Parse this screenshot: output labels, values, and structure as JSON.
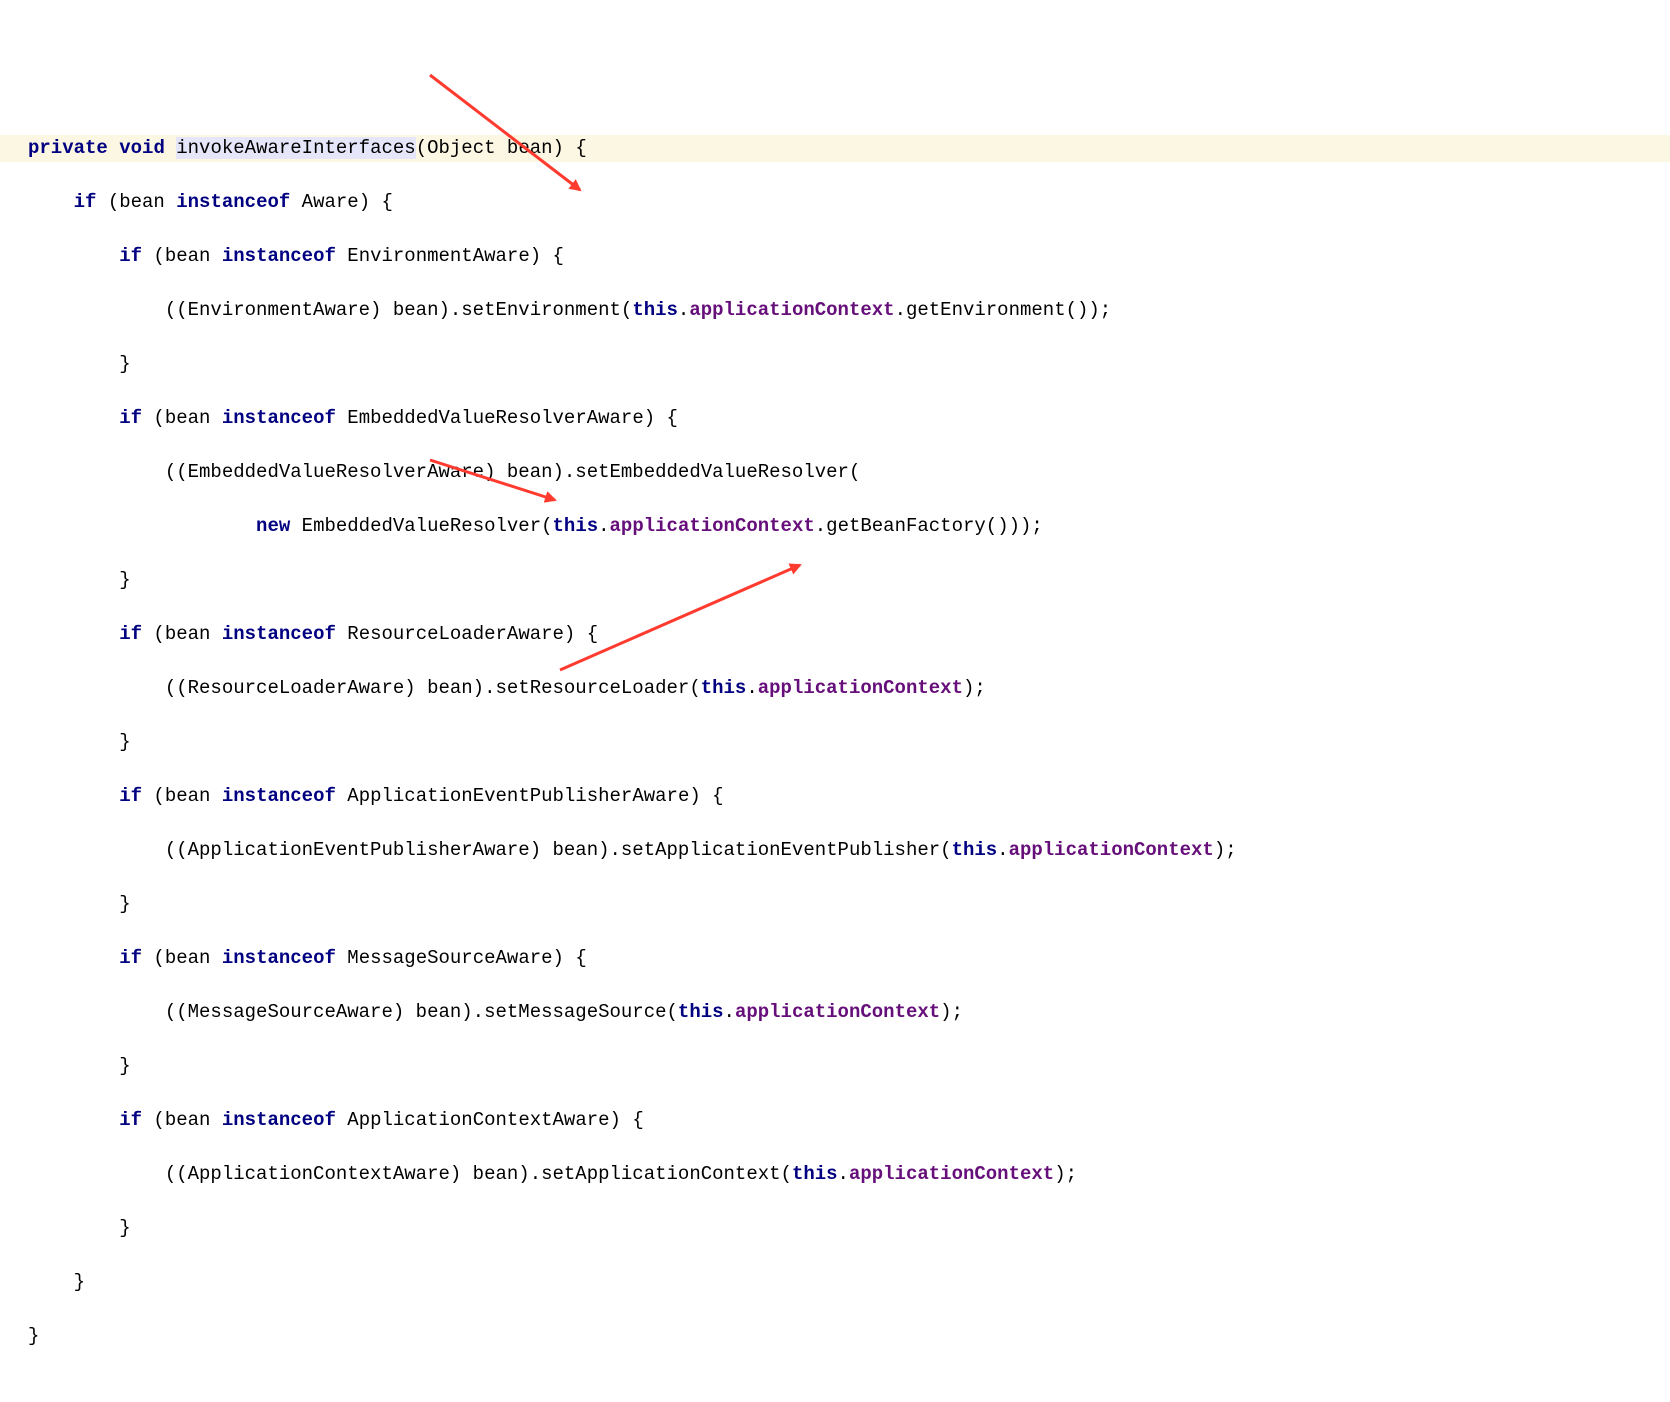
{
  "code": {
    "l1": {
      "kw_private": "private",
      "kw_void": "void",
      "method": "invokeAwareInterfaces",
      "params": "(Object bean) {"
    },
    "l2": {
      "indent": "    ",
      "kw_if": "if",
      "open": " (bean ",
      "kw_instanceof": "instanceof",
      "rest": " Aware) {"
    },
    "l3": {
      "indent": "        ",
      "kw_if": "if",
      "open": " (bean ",
      "kw_instanceof": "instanceof",
      "rest": " EnvironmentAware) {"
    },
    "l4": {
      "indent": "            ",
      "cast": "((EnvironmentAware) bean).setEnvironment(",
      "kw_this": "this",
      "dot1": ".",
      "field": "applicationContext",
      "rest": ".getEnvironment());"
    },
    "l5": {
      "indent": "        ",
      "brace": "}"
    },
    "l6": {
      "indent": "        ",
      "kw_if": "if",
      "open": " (bean ",
      "kw_instanceof": "instanceof",
      "rest": " EmbeddedValueResolverAware) {"
    },
    "l7": {
      "indent": "            ",
      "text": "((EmbeddedValueResolverAware) bean).setEmbeddedValueResolver("
    },
    "l8": {
      "indent": "                    ",
      "kw_new": "new",
      "mid": " EmbeddedValueResolver(",
      "kw_this": "this",
      "dot1": ".",
      "field": "applicationContext",
      "rest": ".getBeanFactory()));"
    },
    "l9": {
      "indent": "        ",
      "brace": "}"
    },
    "l10": {
      "indent": "        ",
      "kw_if": "if",
      "open": " (bean ",
      "kw_instanceof": "instanceof",
      "rest": " ResourceLoaderAware) {"
    },
    "l11": {
      "indent": "            ",
      "cast": "((ResourceLoaderAware) bean).setResourceLoader(",
      "kw_this": "this",
      "dot1": ".",
      "field": "applicationContext",
      "rest": ");"
    },
    "l12": {
      "indent": "        ",
      "brace": "}"
    },
    "l13": {
      "indent": "        ",
      "kw_if": "if",
      "open": " (bean ",
      "kw_instanceof": "instanceof",
      "rest": " ApplicationEventPublisherAware) {"
    },
    "l14": {
      "indent": "            ",
      "cast": "((ApplicationEventPublisherAware) bean).setApplicationEventPublisher(",
      "kw_this": "this",
      "dot1": ".",
      "field": "applicationContext",
      "rest": ");"
    },
    "l15": {
      "indent": "        ",
      "brace": "}"
    },
    "l16": {
      "indent": "        ",
      "kw_if": "if",
      "open": " (bean ",
      "kw_instanceof": "instanceof",
      "rest": " MessageSourceAware) {"
    },
    "l17": {
      "indent": "            ",
      "cast": "((MessageSourceAware) bean).setMessageSource(",
      "kw_this": "this",
      "dot1": ".",
      "field": "applicationContext",
      "rest": ");"
    },
    "l18": {
      "indent": "        ",
      "brace": "}"
    },
    "l19": {
      "indent": "        ",
      "kw_if": "if",
      "open": " (bean ",
      "kw_instanceof": "instanceof",
      "rest": " ApplicationContextAware) {"
    },
    "l20": {
      "indent": "            ",
      "cast": "((ApplicationContextAware) bean).setApplicationContext(",
      "kw_this": "this",
      "dot1": ".",
      "field": "applicationContext",
      "rest": ");"
    },
    "l21": {
      "indent": "        ",
      "brace": "}"
    },
    "l22": {
      "indent": "    ",
      "brace": "}"
    },
    "l23": {
      "indent": "",
      "brace": "}"
    }
  },
  "annotations": {
    "arrow_color": "#ff3b30"
  }
}
